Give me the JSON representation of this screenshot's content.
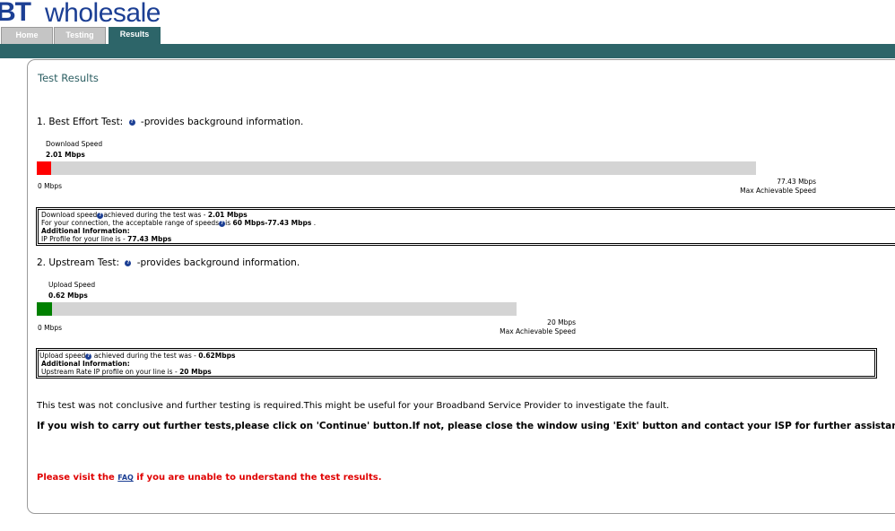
{
  "brand": {
    "bt": "BT",
    "wholesale": "wholesale"
  },
  "tabs": [
    {
      "label": "Home",
      "active": false
    },
    {
      "label": "Testing",
      "active": false
    },
    {
      "label": "Results",
      "active": true
    }
  ],
  "page_title": "Test Results",
  "best_effort": {
    "heading": "1. Best Effort Test:",
    "heading_suffix": "-provides background information.",
    "bar_label": "Download Speed",
    "value_text": "2.01 Mbps",
    "min_label": "0 Mbps",
    "max_label": "77.43 Mbps",
    "max_caption": "Max Achievable Speed",
    "fill_fraction": 0.02,
    "fill_color": "#ff0000",
    "info": {
      "l1_a": "Download speed",
      "l1_b": "achieved during the test was - ",
      "l1_v": "2.01 Mbps",
      "l2_a": "For your connection, the acceptable range of speeds",
      "l2_b": "is ",
      "l2_v": "60 Mbps-77.43 Mbps",
      "l2_c": " .",
      "l3": "Additional Information:",
      "l4_a": "IP Profile for your line is - ",
      "l4_v": "77.43 Mbps"
    }
  },
  "upstream": {
    "heading": "2. Upstream Test:",
    "heading_suffix": "-provides background information.",
    "bar_label": "Upload Speed",
    "value_text": "0.62 Mbps",
    "min_label": "0 Mbps",
    "max_label": "20 Mbps",
    "max_caption": "Max Achievable Speed",
    "fill_fraction": 0.031,
    "fill_color": "#008000",
    "info": {
      "l1_a": "Upload speed",
      "l1_b": " achieved during the test was - ",
      "l1_v": "0.62Mbps",
      "l2": "Additional Information:",
      "l3_a": "Upstream Rate IP profile on your line is - ",
      "l3_v": "20 Mbps"
    }
  },
  "messages": {
    "inconclusive": "This test was not conclusive and further testing is required.This might be useful for your Broadband Service Provider to investigate the fault.",
    "further": "If you wish to carry out further tests,please click on 'Continue' button.If not, please close the window using 'Exit' button and contact your ISP for further assistance w",
    "faq_pre": "Please visit the ",
    "faq_link": "FAQ",
    "faq_post": " if you are unable to understand the test results."
  },
  "colors": {
    "brand_blue": "#1c3f94",
    "band_teal": "#2d6569",
    "track_gray": "#d4d4d4"
  }
}
